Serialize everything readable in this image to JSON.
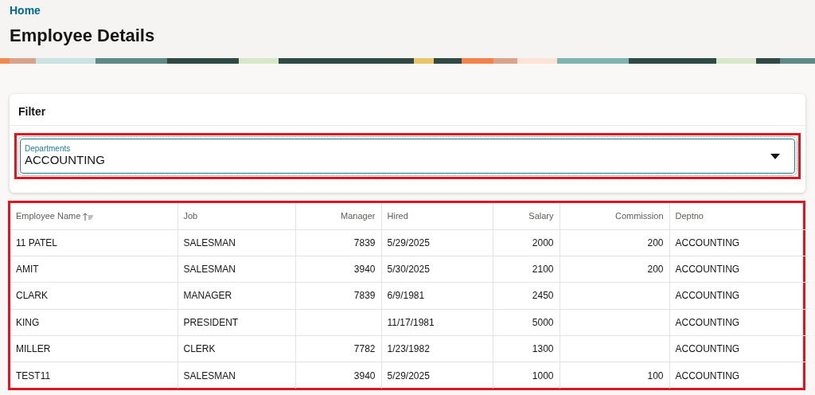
{
  "breadcrumb": "Home",
  "page_title": "Employee Details",
  "filter": {
    "title": "Filter",
    "field": {
      "label": "Departments",
      "value": "ACCOUNTING"
    }
  },
  "table": {
    "columns": [
      {
        "label": "Employee Name",
        "kind": "text",
        "sorted": true
      },
      {
        "label": "Job",
        "kind": "text",
        "sorted": false
      },
      {
        "label": "Manager",
        "kind": "number",
        "sorted": false
      },
      {
        "label": "Hired",
        "kind": "text",
        "sorted": false
      },
      {
        "label": "Salary",
        "kind": "number",
        "sorted": false
      },
      {
        "label": "Commission",
        "kind": "number",
        "sorted": false
      },
      {
        "label": "Deptno",
        "kind": "text",
        "sorted": false
      }
    ],
    "rows": [
      [
        "11 PATEL",
        "SALESMAN",
        "7839",
        "5/29/2025",
        "2000",
        "200",
        "ACCOUNTING"
      ],
      [
        "AMIT",
        "SALESMAN",
        "3940",
        "5/30/2025",
        "2100",
        "200",
        "ACCOUNTING"
      ],
      [
        "CLARK",
        "MANAGER",
        "7839",
        "6/9/1981",
        "2450",
        "",
        "ACCOUNTING"
      ],
      [
        "KING",
        "PRESIDENT",
        "",
        "11/17/1981",
        "5000",
        "",
        "ACCOUNTING"
      ],
      [
        "MILLER",
        "CLERK",
        "7782",
        "1/23/1982",
        "1300",
        "",
        "ACCOUNTING"
      ],
      [
        "TEST11",
        "SALESMAN",
        "3940",
        "5/29/2025",
        "1000",
        "100",
        "ACCOUNTING"
      ]
    ]
  }
}
